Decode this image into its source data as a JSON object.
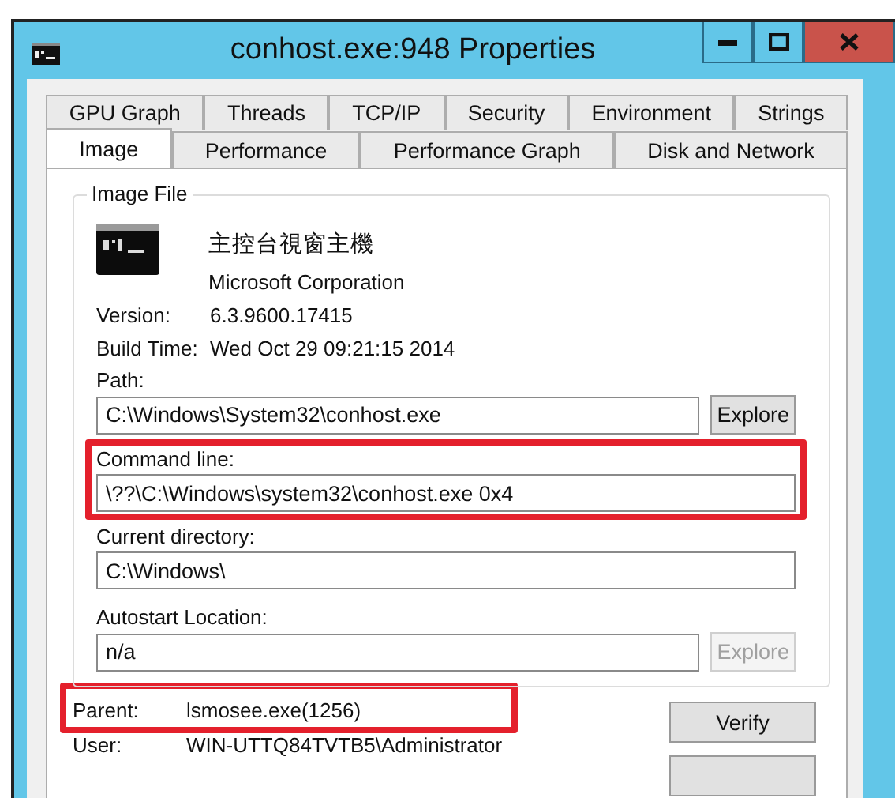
{
  "window": {
    "title": "conhost.exe:948 Properties"
  },
  "tabs_row_1": [
    {
      "label": "GPU Graph",
      "selected": false
    },
    {
      "label": "Threads",
      "selected": false
    },
    {
      "label": "TCP/IP",
      "selected": false
    },
    {
      "label": "Security",
      "selected": false
    },
    {
      "label": "Environment",
      "selected": false
    },
    {
      "label": "Strings",
      "selected": false
    }
  ],
  "tabs_row_2": [
    {
      "label": "Image",
      "selected": true
    },
    {
      "label": "Performance",
      "selected": false
    },
    {
      "label": "Performance Graph",
      "selected": false
    },
    {
      "label": "Disk and Network",
      "selected": false
    }
  ],
  "image_file": {
    "title": "Image File",
    "description": "主控台視窗主機",
    "company": "Microsoft Corporation",
    "info": [
      {
        "label": "Version:",
        "value": "6.3.9600.17415"
      },
      {
        "label": "Build Time:",
        "value": "Wed Oct 29 09:21:15 2014"
      }
    ],
    "fields": [
      {
        "label": "Path:",
        "value": "C:\\Windows\\System32\\conhost.exe",
        "button": {
          "label": "Explore",
          "disabled": false
        },
        "highlighted": false
      },
      {
        "label": "Command line:",
        "value": "\\??\\C:\\Windows\\system32\\conhost.exe 0x4",
        "highlighted": true
      },
      {
        "label": "Current directory:",
        "value": "C:\\Windows\\",
        "highlighted": false
      },
      {
        "label": "Autostart Location:",
        "value": "n/a",
        "button": {
          "label": "Explore",
          "disabled": true
        },
        "highlighted": false
      }
    ]
  },
  "details": [
    {
      "label": "Parent:",
      "value": "lsmosee.exe(1256)",
      "highlighted": true
    },
    {
      "label": "User:",
      "value": "WIN-UTTQ84TVTB5\\Administrator",
      "highlighted": false
    }
  ],
  "buttons": [
    {
      "label": "Verify"
    }
  ]
}
